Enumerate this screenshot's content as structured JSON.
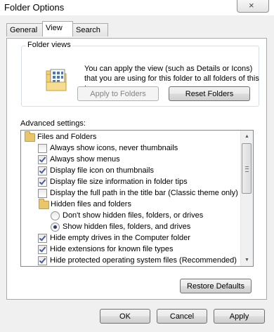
{
  "window": {
    "title": "Folder Options",
    "close_glyph": "×"
  },
  "tabs": [
    {
      "label": "General",
      "active": false
    },
    {
      "label": "View",
      "active": true
    },
    {
      "label": "Search",
      "active": false
    }
  ],
  "folder_views": {
    "title": "Folder views",
    "description": "You can apply the view (such as Details or Icons) that you are using for this folder to all folders of this type.",
    "apply_label": "Apply to Folders",
    "reset_label": "Reset Folders"
  },
  "advanced": {
    "label": "Advanced settings:",
    "items": [
      {
        "type": "folder",
        "label": "Files and Folders"
      },
      {
        "type": "checkbox",
        "checked": false,
        "label": "Always show icons, never thumbnails"
      },
      {
        "type": "checkbox",
        "checked": true,
        "label": "Always show menus"
      },
      {
        "type": "checkbox",
        "checked": true,
        "label": "Display file icon on thumbnails"
      },
      {
        "type": "checkbox",
        "checked": true,
        "label": "Display file size information in folder tips"
      },
      {
        "type": "checkbox",
        "checked": false,
        "label": "Display the full path in the title bar (Classic theme only)"
      },
      {
        "type": "folder",
        "label": "Hidden files and folders"
      },
      {
        "type": "radio",
        "checked": false,
        "label": "Don't show hidden files, folders, or drives"
      },
      {
        "type": "radio",
        "checked": true,
        "label": "Show hidden files, folders, and drives"
      },
      {
        "type": "checkbox",
        "checked": true,
        "label": "Hide empty drives in the Computer folder"
      },
      {
        "type": "checkbox",
        "checked": true,
        "label": "Hide extensions for known file types"
      },
      {
        "type": "checkbox",
        "checked": true,
        "label": "Hide protected operating system files (Recommended)"
      }
    ]
  },
  "restore_label": "Restore Defaults",
  "footer": {
    "ok": "OK",
    "cancel": "Cancel",
    "apply": "Apply"
  }
}
